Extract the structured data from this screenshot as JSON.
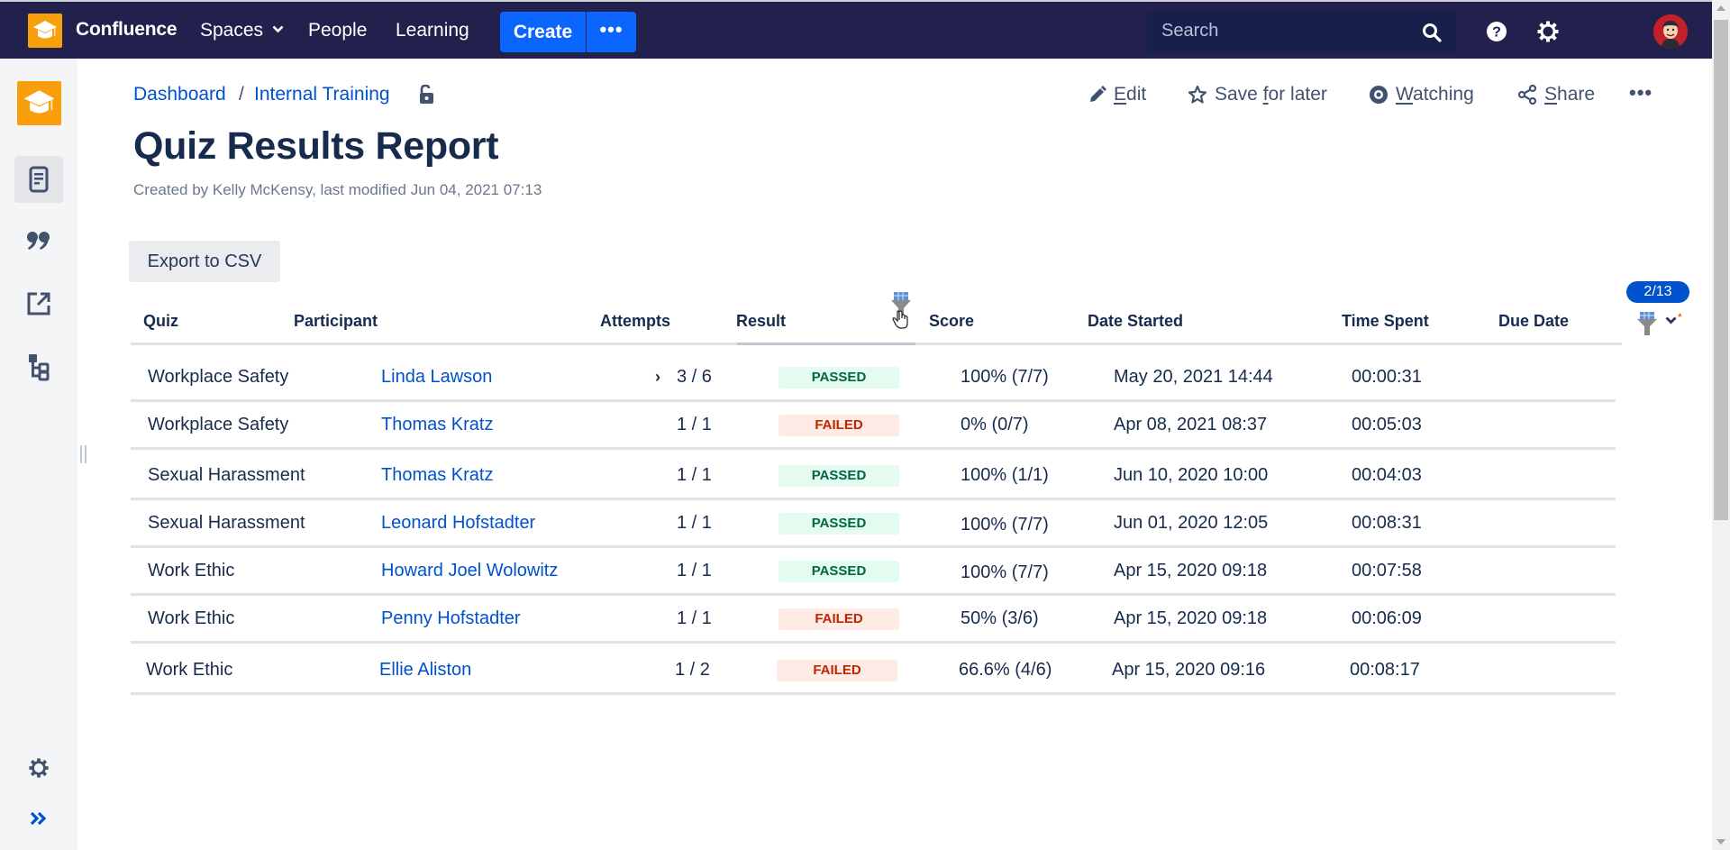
{
  "topnav": {
    "brand": "Confluence",
    "spaces_label": "Spaces",
    "people_label": "People",
    "learning_label": "Learning",
    "create_label": "Create",
    "more_label": "•••",
    "search_placeholder": "Search",
    "icons": {
      "logo": "confluence-graduation-cap-logo",
      "spaces_dropdown": "chevron-down-icon",
      "search": "search-icon",
      "help": "help-icon",
      "settings": "gear-icon",
      "profile": "avatar"
    }
  },
  "sidebar": {
    "items": [
      {
        "name": "space-logo",
        "icon": "graduation-cap-icon"
      },
      {
        "name": "pages",
        "icon": "page-icon",
        "active": true
      },
      {
        "name": "blog",
        "icon": "quote-icon"
      },
      {
        "name": "shortcuts",
        "icon": "external-link-icon"
      },
      {
        "name": "page-tree",
        "icon": "hierarchy-icon"
      }
    ],
    "bottom": [
      {
        "name": "space-settings",
        "icon": "gear-icon"
      },
      {
        "name": "expand-sidebar",
        "icon": "double-chevron-right-icon"
      }
    ]
  },
  "breadcrumb": {
    "items": [
      "Dashboard",
      "Internal Training"
    ],
    "separator": "/",
    "restriction_icon": "unlock-icon"
  },
  "page": {
    "title": "Quiz Results Report",
    "meta": "Created by Kelly McKensy, last modified Jun 04, 2021 07:13"
  },
  "actions": {
    "edit": {
      "prefix": "",
      "key": "E",
      "rest": "dit"
    },
    "save": {
      "prefix": "Save ",
      "key": "f",
      "rest": "or later"
    },
    "watch": {
      "prefix": "",
      "key": "W",
      "rest": "atching"
    },
    "share": {
      "prefix": "",
      "key": "S",
      "rest": "hare"
    },
    "more": "•••"
  },
  "export_label": "Export to CSV",
  "table": {
    "columns": [
      "Quiz",
      "Participant",
      "Attempts",
      "Result",
      "Score",
      "Date Started",
      "Time Spent",
      "Due Date"
    ],
    "filter_counter": "2/13",
    "filter_active_marker": "*",
    "rows": [
      {
        "quiz": "Workplace Safety",
        "participant": "Linda Lawson",
        "attempts": "3 / 6",
        "expandable": true,
        "result": "PASSED",
        "score": "100% (7/7)",
        "date_started": "May 20, 2021 14:44",
        "time_spent": "00:00:31",
        "due_date": ""
      },
      {
        "quiz": "Workplace Safety",
        "participant": "Thomas Kratz",
        "attempts": "1 / 1",
        "expandable": false,
        "result": "FAILED",
        "score": "0% (0/7)",
        "date_started": "Apr 08, 2021 08:37",
        "time_spent": "00:05:03",
        "due_date": ""
      },
      {
        "quiz": "Sexual Harassment",
        "participant": "Thomas Kratz",
        "attempts": "1 / 1",
        "expandable": false,
        "result": "PASSED",
        "score": "100% (1/1)",
        "date_started": "Jun 10, 2020 10:00",
        "time_spent": "00:04:03",
        "due_date": ""
      },
      {
        "quiz": "Sexual Harassment",
        "participant": "Leonard Hofstadter",
        "attempts": "1 / 1",
        "expandable": false,
        "result": "PASSED",
        "score": "100% (7/7)",
        "date_started": "Jun 01, 2020 12:05",
        "time_spent": "00:08:31",
        "due_date": ""
      },
      {
        "quiz": "Work Ethic",
        "participant": "Howard Joel Wolowitz",
        "attempts": "1 / 1",
        "expandable": false,
        "result": "PASSED",
        "score": "100% (7/7)",
        "date_started": "Apr 15, 2020 09:18",
        "time_spent": "00:07:58",
        "due_date": ""
      },
      {
        "quiz": "Work Ethic",
        "participant": "Penny Hofstadter",
        "attempts": "1 / 1",
        "expandable": false,
        "result": "FAILED",
        "score": "50% (3/6)",
        "date_started": "Apr 15, 2020 09:18",
        "time_spent": "00:06:09",
        "due_date": ""
      },
      {
        "quiz": "Work Ethic",
        "participant": "Ellie Aliston",
        "attempts": "1 / 2",
        "expandable": false,
        "result": "FAILED",
        "score": "66.6% (4/6)",
        "date_started": "Apr 15, 2020 09:16",
        "time_spent": "00:08:17",
        "due_date": ""
      }
    ]
  },
  "colors": {
    "nav_bg": "#22204c",
    "accent": "#0b66ff",
    "link": "#0052cc",
    "brand_orange": "#f99f0c",
    "passed_bg": "#e3fcef",
    "passed_text": "#006644",
    "failed_bg": "#ffebe6",
    "failed_text": "#bf2600"
  }
}
